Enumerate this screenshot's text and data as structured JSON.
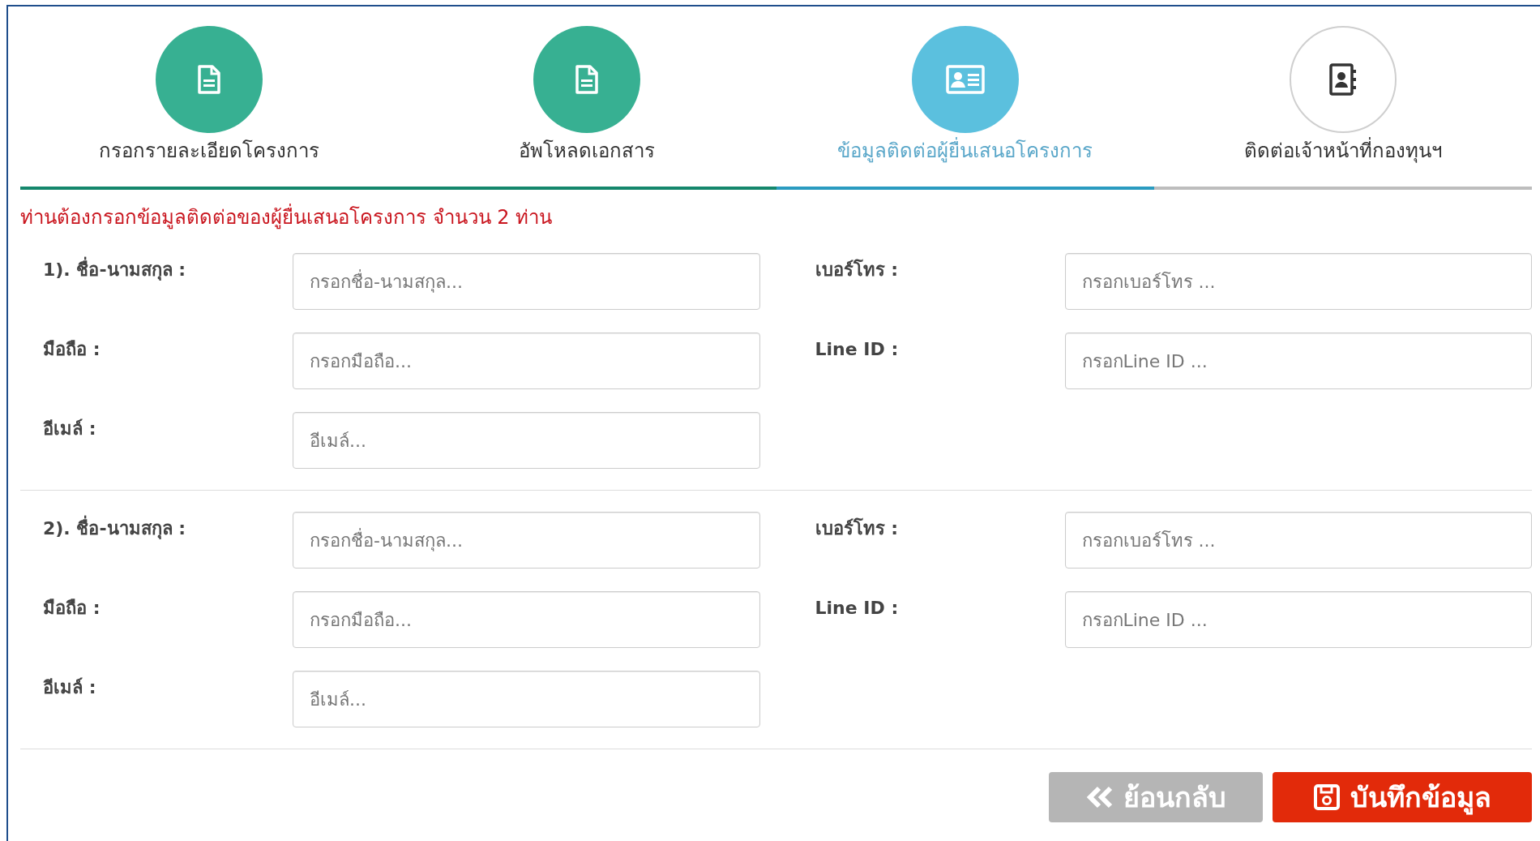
{
  "steps": [
    {
      "label": "กรอกรายละเอียดโครงการ",
      "completed": true,
      "selected": false,
      "kind": "document"
    },
    {
      "label": "อัพโหลดเอกสาร",
      "completed": true,
      "selected": false,
      "kind": "document"
    },
    {
      "label": "ข้อมูลติดต่อผู้ยื่นเสนอโครงการ",
      "completed": false,
      "selected": true,
      "kind": "card"
    },
    {
      "label": "ติดต่อเจ้าหน้าที่กองทุนฯ",
      "completed": false,
      "selected": false,
      "kind": "contacts"
    }
  ],
  "notice": "ท่านต้องกรอกข้อมูลติดต่อของผู้ยื่นเสนอโครงการ จำนวน 2 ท่าน",
  "contacts": [
    {
      "fields": [
        {
          "label": "1). ชื่อ-นามสกุล :",
          "placeholder": "กรอกชื่อ-นามสกุล..."
        },
        {
          "label": "เบอร์โทร :",
          "placeholder": "กรอกเบอร์โทร ..."
        },
        {
          "label": "มือถือ :",
          "placeholder": "กรอกมือถือ..."
        },
        {
          "label": "Line ID :",
          "placeholder": "กรอกLine ID ..."
        },
        {
          "label": "อีเมล์ :",
          "placeholder": "อีเมล์..."
        }
      ]
    },
    {
      "fields": [
        {
          "label": "2). ชื่อ-นามสกุล :",
          "placeholder": "กรอกชื่อ-นามสกุล..."
        },
        {
          "label": "เบอร์โทร :",
          "placeholder": "กรอกเบอร์โทร ..."
        },
        {
          "label": "มือถือ :",
          "placeholder": "กรอกมือถือ..."
        },
        {
          "label": "Line ID :",
          "placeholder": "กรอกLine ID ..."
        },
        {
          "label": "อีเมล์ :",
          "placeholder": "อีเมล์..."
        }
      ]
    }
  ],
  "buttons": [
    {
      "label": "ย้อนกลับ",
      "kind": "back"
    },
    {
      "label": "บันทึกข้อมูล",
      "kind": "save"
    }
  ]
}
